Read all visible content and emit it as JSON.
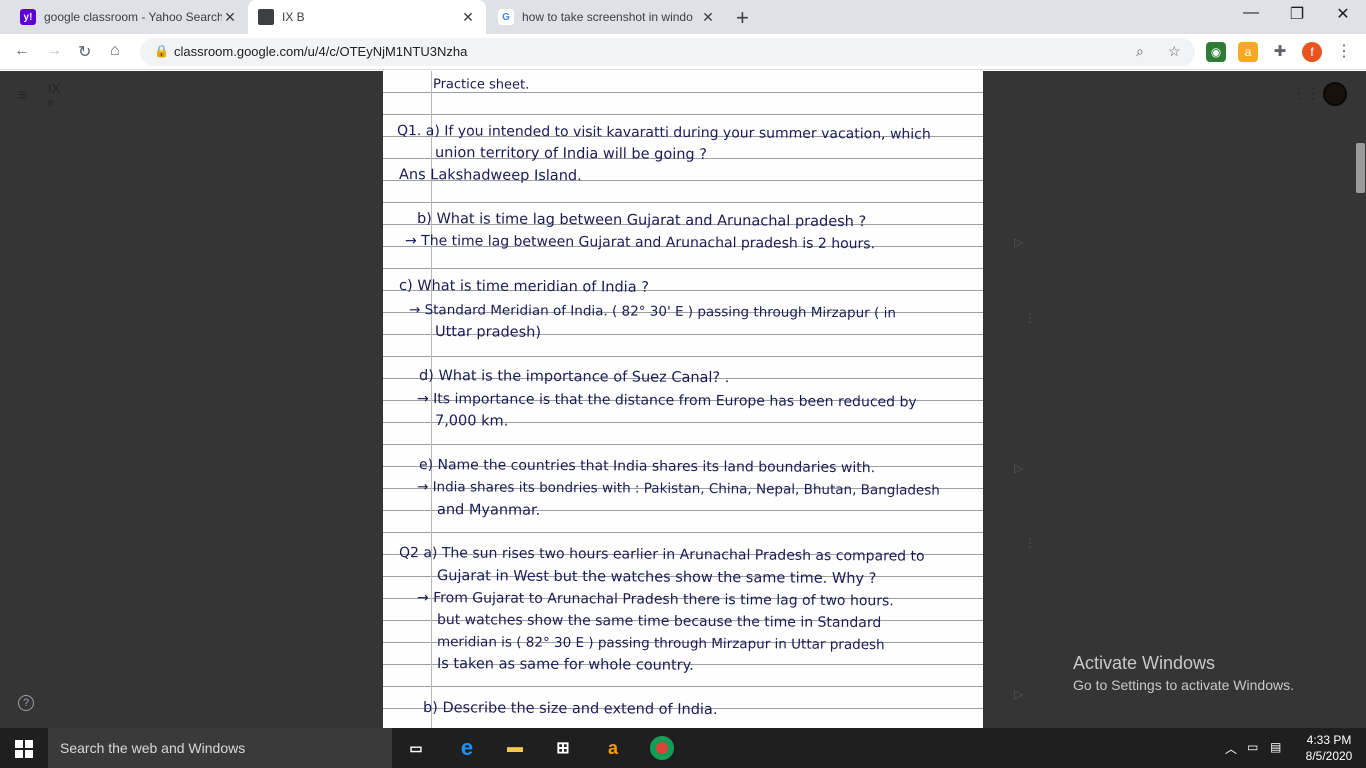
{
  "browser": {
    "tabs": [
      {
        "title": "google classroom - Yahoo Search",
        "favicon": "yahoo-icon",
        "favicon_text": "y!",
        "favicon_color": "#5f01d1"
      },
      {
        "title": "IX B",
        "favicon": "classroom-icon",
        "favicon_text": "",
        "favicon_color": "#3c4043"
      },
      {
        "title": "how to take screenshot in windo",
        "favicon": "google-icon",
        "favicon_text": "G",
        "favicon_color": "#4285f4"
      }
    ],
    "url": "classroom.google.com/u/4/c/OTEyNjM1NTU3Nzha",
    "profile_initial": "f"
  },
  "classroom": {
    "class_name": "IX",
    "class_section": "B"
  },
  "notebook": {
    "lines": [
      "Practice sheet.",
      "Q1. a) If you intended to visit kavaratti during your summer vacation, which",
      "union territory of India will be going ?",
      "Ans Lakshadweep Island.",
      "b) What is time lag between Gujarat and Arunachal pradesh ?",
      "→ The time lag between Gujarat and Arunachal pradesh is 2 hours.",
      "c) What is time meridian of India ?",
      "→ Standard Meridian of India. ( 82° 30' E ) passing through Mirzapur ( in",
      "Uttar pradesh)",
      "d) What is the importance of Suez Canal? .",
      "→ Its importance is that the distance from Europe has been reduced by",
      "7,000 km.",
      "e) Name the countries that India shares its land boundaries with.",
      "→ India shares its bondries with : Pakistan, China, Nepal, Bhutan, Bangladesh",
      "and Myanmar.",
      "Q2 a) The sun rises two hours earlier in Arunachal Pradesh as compared to",
      "Gujarat in West but the watches show the same time. Why ?",
      "→ From Gujarat to Arunachal Pradesh there is time lag of two hours.",
      "but watches show the same time because the time in Standard",
      "meridian is ( 82° 30 E ) passing through Mirzapur in Uttar pradesh",
      "Is taken as same for whole country.",
      "b) Describe the size and extend of India."
    ]
  },
  "watermark": {
    "title": "Activate Windows",
    "subtitle": "Go to Settings to activate Windows."
  },
  "taskbar": {
    "search_placeholder": "Search the web and Windows",
    "time": "4:33 PM",
    "date": "8/5/2020"
  }
}
